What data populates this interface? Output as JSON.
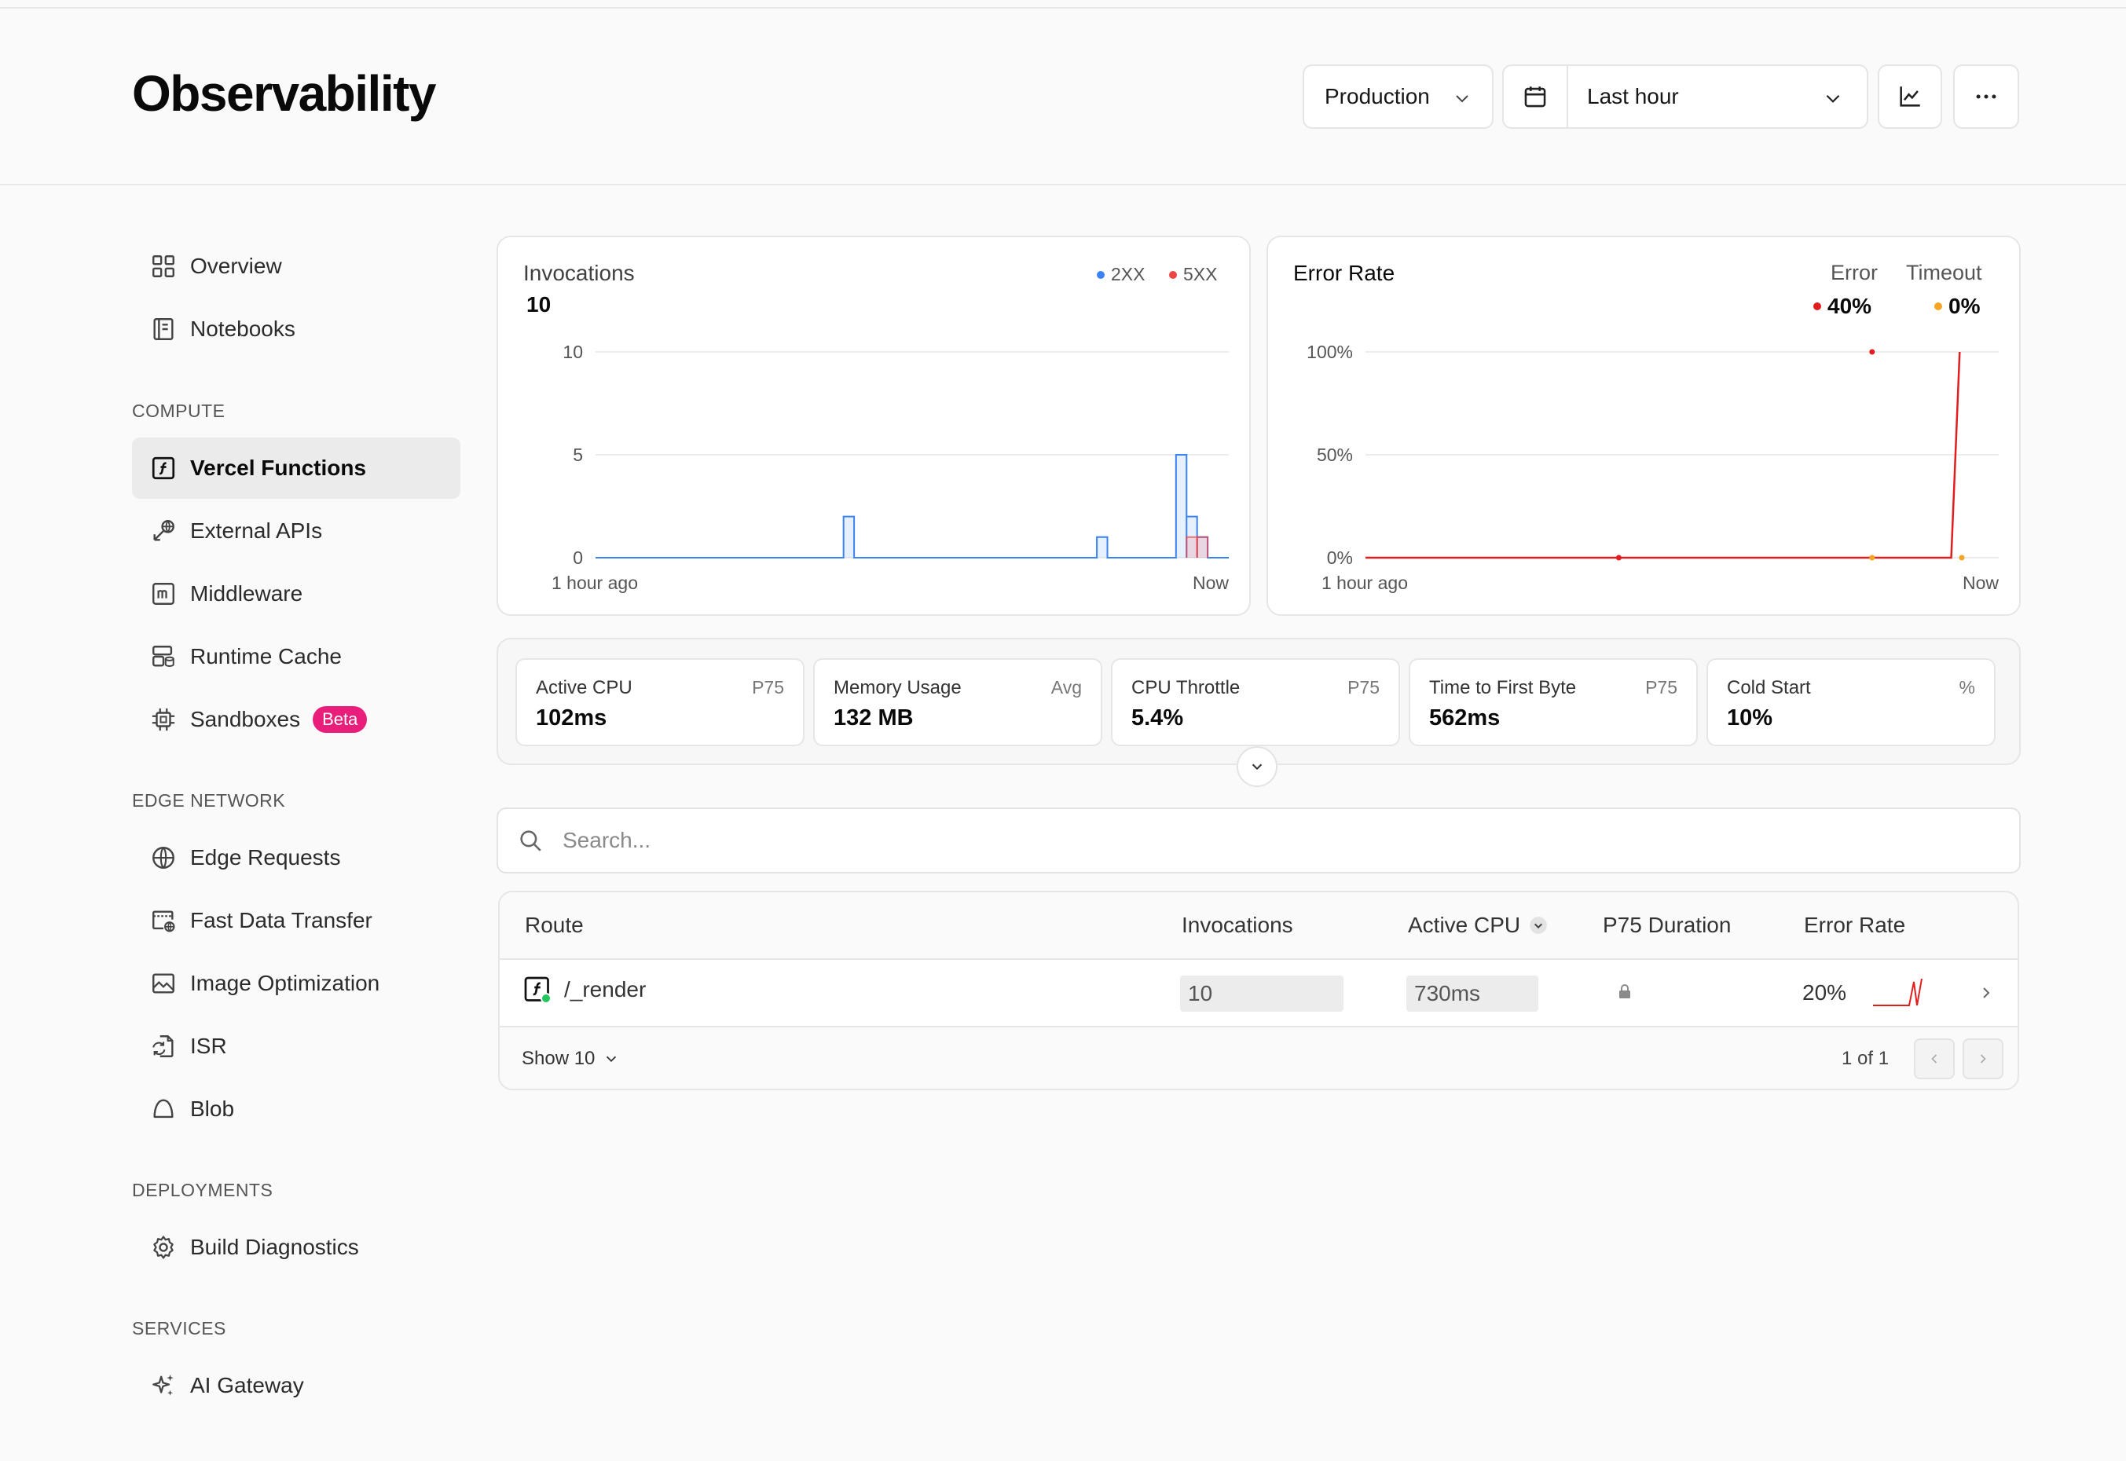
{
  "header": {
    "title": "Observability",
    "environment": "Production",
    "time_range": "Last hour"
  },
  "sidebar": {
    "top_items": [
      {
        "label": "Overview",
        "icon": "grid-icon"
      },
      {
        "label": "Notebooks",
        "icon": "notebook-icon"
      }
    ],
    "sections": [
      {
        "label": "COMPUTE",
        "items": [
          {
            "label": "Vercel Functions",
            "icon": "function-icon",
            "active": true
          },
          {
            "label": "External APIs",
            "icon": "external-api-icon"
          },
          {
            "label": "Middleware",
            "icon": "middleware-icon"
          },
          {
            "label": "Runtime Cache",
            "icon": "cache-icon"
          },
          {
            "label": "Sandboxes",
            "icon": "chip-icon",
            "badge": "Beta"
          }
        ]
      },
      {
        "label": "EDGE NETWORK",
        "items": [
          {
            "label": "Edge Requests",
            "icon": "globe-icon"
          },
          {
            "label": "Fast Data Transfer",
            "icon": "data-transfer-icon"
          },
          {
            "label": "Image Optimization",
            "icon": "image-icon"
          },
          {
            "label": "ISR",
            "icon": "isr-icon"
          },
          {
            "label": "Blob",
            "icon": "blob-icon"
          }
        ]
      },
      {
        "label": "DEPLOYMENTS",
        "items": [
          {
            "label": "Build Diagnostics",
            "icon": "gear-icon"
          }
        ]
      },
      {
        "label": "SERVICES",
        "items": [
          {
            "label": "AI Gateway",
            "icon": "sparkles-icon"
          }
        ]
      }
    ]
  },
  "invocations_card": {
    "title": "Invocations",
    "total": "10",
    "legend": [
      "2XX",
      "5XX"
    ]
  },
  "error_card": {
    "title": "Error Rate",
    "legend": [
      {
        "label": "Error",
        "value": "40%"
      },
      {
        "label": "Timeout",
        "value": "0%"
      }
    ]
  },
  "chart_data": [
    {
      "type": "area",
      "title": "Invocations",
      "x_start_label": "1 hour ago",
      "x_end_label": "Now",
      "y_ticks": [
        "10",
        "5",
        "0"
      ],
      "ylim": [
        0,
        10
      ],
      "x_domain": [
        0,
        60
      ],
      "step": 1,
      "series": [
        {
          "name": "2XX",
          "color": "#3b82f6",
          "points": [
            [
              23.5,
              2
            ],
            [
              47.5,
              1
            ],
            [
              55,
              5
            ],
            [
              56,
              2
            ],
            [
              57,
              1
            ]
          ]
        },
        {
          "name": "5XX",
          "color": "#ef4444",
          "points": [
            [
              56,
              1
            ],
            [
              57,
              1
            ]
          ]
        }
      ]
    },
    {
      "type": "line",
      "title": "Error Rate",
      "x_start_label": "1 hour ago",
      "x_end_label": "Now",
      "y_ticks": [
        "100%",
        "50%",
        "0%"
      ],
      "ylim": [
        0,
        100
      ],
      "x_domain": [
        0,
        60
      ],
      "series": [
        {
          "name": "Error",
          "color": "#e11d1d",
          "points": [
            [
              0,
              0
            ],
            [
              54,
              0
            ],
            [
              55.5,
              0
            ],
            [
              56.3,
              100
            ]
          ],
          "dots": [
            [
              24,
              0
            ],
            [
              48,
              100
            ]
          ]
        },
        {
          "name": "Timeout",
          "color": "#f5a524",
          "points": [],
          "dots": [
            [
              48,
              0
            ],
            [
              56.5,
              0
            ]
          ]
        }
      ]
    }
  ],
  "metrics": [
    {
      "label": "Active CPU",
      "stat": "P75",
      "value": "102ms"
    },
    {
      "label": "Memory Usage",
      "stat": "Avg",
      "value": "132 MB"
    },
    {
      "label": "CPU Throttle",
      "stat": "P75",
      "value": "5.4%"
    },
    {
      "label": "Time to First Byte",
      "stat": "P75",
      "value": "562ms"
    },
    {
      "label": "Cold Start",
      "stat": "%",
      "value": "10%"
    }
  ],
  "search": {
    "placeholder": "Search..."
  },
  "table": {
    "columns": [
      "Route",
      "Invocations",
      "Active CPU",
      "P75 Duration",
      "Error Rate"
    ],
    "rows": [
      {
        "route": "/_render",
        "invocations": "10",
        "active_cpu": "730ms",
        "error_rate": "20%",
        "status_color": "#22c55e"
      }
    ],
    "show_label": "Show 10",
    "page_label": "1 of 1"
  },
  "colors": {
    "accent_blue": "#3b82f6",
    "error_red": "#e11d1d",
    "timeout_orange": "#f5a524",
    "beta_pink": "#e91e7a"
  }
}
